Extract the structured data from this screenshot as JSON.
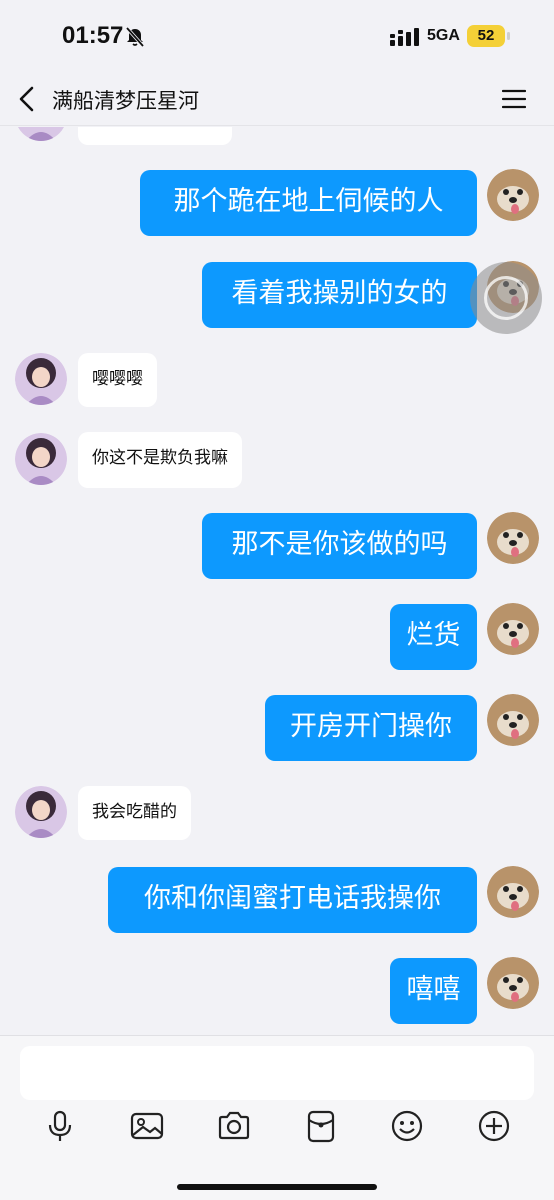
{
  "status_bar": {
    "time": "01:57",
    "network": "5GA",
    "battery": "52"
  },
  "header": {
    "title": "满船清梦压星河"
  },
  "colors": {
    "outgoing_bubble": "#0d99fe",
    "incoming_bubble": "#ffffff",
    "background": "#f2f2f6",
    "battery": "#f4d037"
  },
  "messages": [
    {
      "side": "in",
      "text": ""
    },
    {
      "side": "out",
      "text": "那个跪在地上伺候的人"
    },
    {
      "side": "out",
      "text": "看着我操别的女的"
    },
    {
      "side": "in",
      "text": "嘤嘤嘤"
    },
    {
      "side": "in",
      "text": "你这不是欺负我嘛"
    },
    {
      "side": "out",
      "text": "那不是你该做的吗"
    },
    {
      "side": "out",
      "text": "烂货"
    },
    {
      "side": "out",
      "text": "开房开门操你"
    },
    {
      "side": "in",
      "text": "我会吃醋的"
    },
    {
      "side": "out",
      "text": "你和你闺蜜打电话我操你"
    },
    {
      "side": "out",
      "text": "嘻嘻"
    }
  ],
  "input": {
    "placeholder": ""
  },
  "toolbar": {
    "icons": [
      "microphone-icon",
      "image-icon",
      "camera-icon",
      "red-packet-icon",
      "emoji-icon",
      "plus-icon"
    ]
  }
}
